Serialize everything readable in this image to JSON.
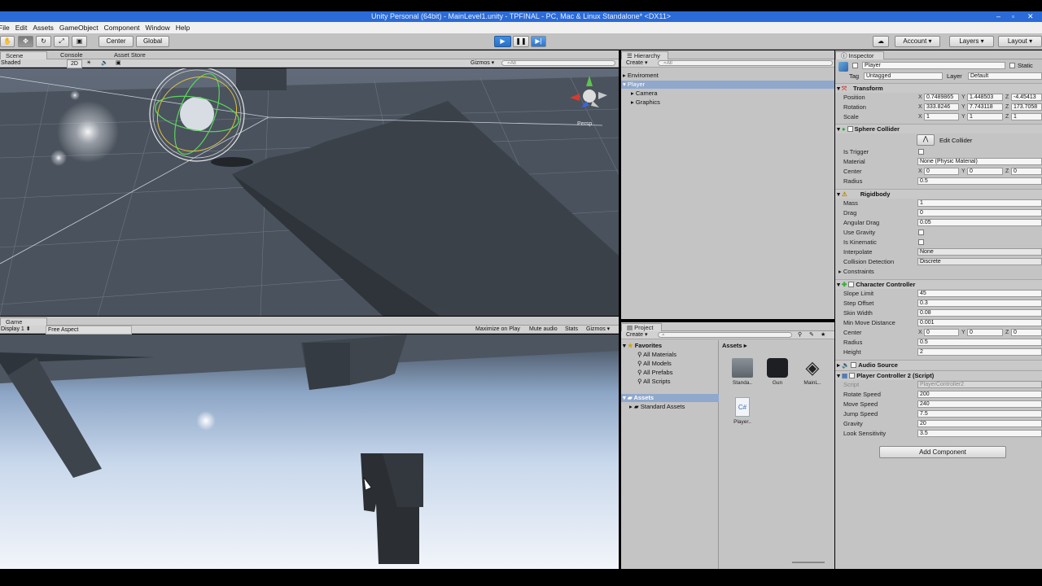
{
  "window": {
    "title": "Unity Personal (64bit) - MainLevel1.unity - TPFINAL - PC, Mac & Linux Standalone* <DX11>"
  },
  "menu": [
    "File",
    "Edit",
    "Assets",
    "GameObject",
    "Component",
    "Window",
    "Help"
  ],
  "toolbar": {
    "pivot": "Center",
    "space": "Global",
    "cloud": "",
    "account": "Account",
    "layers": "Layers",
    "layout": "Layout"
  },
  "scene": {
    "tabs": [
      "Scene",
      "Console",
      "Asset Store"
    ],
    "shading": "Shaded",
    "mode2d": "2D",
    "gizmos": "Gizmos",
    "search": "All",
    "persp": "Persp"
  },
  "game": {
    "tab": "Game",
    "display": "Display 1",
    "aspect": "Free Aspect",
    "maximize": "Maximize on Play",
    "mute": "Mute audio",
    "stats": "Stats",
    "gizmos": "Gizmos"
  },
  "hierarchy": {
    "tab": "Hierarchy",
    "create": "Create",
    "search": "All",
    "items": [
      "Enviroment",
      "Player",
      "Camera",
      "Graphics"
    ]
  },
  "project": {
    "tab": "Project",
    "create": "Create",
    "favorites_label": "Favorites",
    "favorites": [
      "All Materials",
      "All Models",
      "All Prefabs",
      "All Scripts"
    ],
    "assets_label": "Assets",
    "folders": [
      "Standard Assets"
    ],
    "breadcrumb": "Assets",
    "assets": [
      "Standa..",
      "Gun",
      "MainL..",
      "Player.."
    ]
  },
  "inspector": {
    "tab": "Inspector",
    "object_name": "Player",
    "static": "Static",
    "tag_label": "Tag",
    "tag": "Untagged",
    "layer_label": "Layer",
    "layer": "Default",
    "transform": {
      "title": "Transform",
      "position_label": "Position",
      "position": [
        "0.7489865",
        "1.448503",
        "-4.45413"
      ],
      "rotation_label": "Rotation",
      "rotation": [
        "333.8246",
        "7.743118",
        "173.7058"
      ],
      "scale_label": "Scale",
      "scale": [
        "1",
        "1",
        "1"
      ]
    },
    "sphere_collider": {
      "title": "Sphere Collider",
      "edit": "Edit Collider",
      "is_trigger": "Is Trigger",
      "material_label": "Material",
      "material": "None (Physic Material)",
      "center_label": "Center",
      "center": [
        "0",
        "0",
        "0"
      ],
      "radius_label": "Radius",
      "radius": "0.5"
    },
    "rigidbody": {
      "title": "Rigidbody",
      "mass_label": "Mass",
      "mass": "1",
      "drag_label": "Drag",
      "drag": "0",
      "angular_drag_label": "Angular Drag",
      "angular_drag": "0.05",
      "use_gravity": "Use Gravity",
      "is_kinematic": "Is Kinematic",
      "interpolate_label": "Interpolate",
      "interpolate": "None",
      "collision_label": "Collision Detection",
      "collision": "Discrete",
      "constraints": "Constraints"
    },
    "character_controller": {
      "title": "Character Controller",
      "slope_label": "Slope Limit",
      "slope": "45",
      "step_label": "Step Offset",
      "step": "0.3",
      "skin_label": "Skin Width",
      "skin": "0.08",
      "minmove_label": "Min Move Distance",
      "minmove": "0.001",
      "center_label": "Center",
      "center": [
        "0",
        "0",
        "0"
      ],
      "radius_label": "Radius",
      "radius": "0.5",
      "height_label": "Height",
      "height": "2"
    },
    "audio_source": {
      "title": "Audio Source"
    },
    "player_controller": {
      "title": "Player Controller 2 (Script)",
      "script_label": "Script",
      "script": "PlayerController2",
      "rotate_label": "Rotate Speed",
      "rotate": "200",
      "move_label": "Move Speed",
      "move": "240",
      "jump_label": "Jump Speed",
      "jump": "7.5",
      "gravity_label": "Gravity",
      "gravity": "20",
      "look_label": "Look Sensitivity",
      "look": "3.5"
    },
    "add_component": "Add Component"
  },
  "colors": {
    "accent": "#2a6bd8",
    "play_active": "#3d8ee6",
    "panel": "#c4c4c4"
  }
}
